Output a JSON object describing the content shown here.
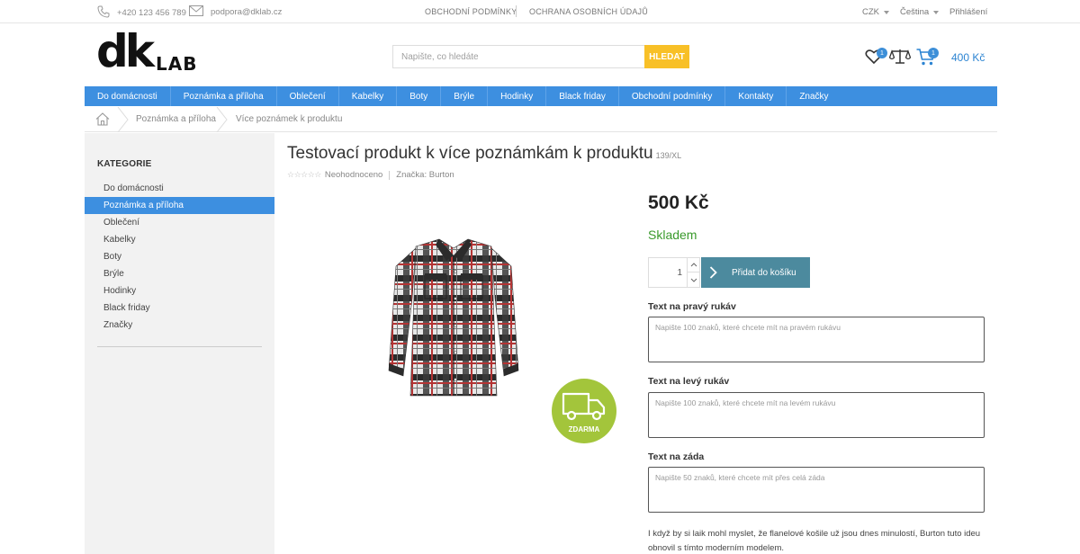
{
  "topbar": {
    "phone": "+420 123 456 789",
    "email": "podpora@dklab.cz",
    "links": [
      "OBCHODNÍ PODMÍNKY",
      "OCHRANA OSOBNÍCH ÚDAJŮ"
    ],
    "currency": "CZK",
    "language": "Čeština",
    "login": "Přihlášení"
  },
  "header": {
    "logo_main": "dk",
    "logo_sub": "LAB",
    "search_placeholder": "Napište, co hledáte",
    "search_button": "HLEDAT",
    "wishlist_count": "1",
    "cart_count": "1",
    "cart_total": "400 Kč"
  },
  "nav": {
    "items": [
      "Do domácnosti",
      "Poznámka a příloha",
      "Oblečení",
      "Kabelky",
      "Boty",
      "Brýle",
      "Hodinky",
      "Black friday",
      "Obchodní podmínky",
      "Kontakty",
      "Značky"
    ]
  },
  "breadcrumb": {
    "items": [
      "Poznámka a příloha",
      "Více poznámek k produktu"
    ]
  },
  "sidebar": {
    "title": "KATEGORIE",
    "items": [
      "Do domácnosti",
      "Poznámka a příloha",
      "Oblečení",
      "Kabelky",
      "Boty",
      "Brýle",
      "Hodinky",
      "Black friday",
      "Značky"
    ],
    "active_index": 1
  },
  "product": {
    "title": "Testovací produkt k více poznámkám k produktu",
    "code": "139/XL",
    "rating_text": "Neohodnoceno",
    "brand": "Značka: Burton",
    "shipping_badge": "ZDARMA",
    "price": "500 Kč",
    "availability": "Skladem",
    "quantity": "1",
    "add_to_cart": "Přidat do košíku",
    "accent_color": "#4c8a9e",
    "availability_color": "#3a9a2c",
    "fields": [
      {
        "label": "Text na pravý rukáv",
        "placeholder": "Napište 100 znaků, které chcete mít na pravém rukávu"
      },
      {
        "label": "Text na levý rukáv",
        "placeholder": "Napište 100 znaků, které chcete mít na levém rukávu"
      },
      {
        "label": "Text na záda",
        "placeholder": "Napište 50 znaků, které chcete mít přes celá záda"
      }
    ],
    "description": "I když by si laik mohl myslet, že flanelové košile už jsou dnes minulostí, Burton tuto ideu obnovil s tímto moderním modelem."
  }
}
